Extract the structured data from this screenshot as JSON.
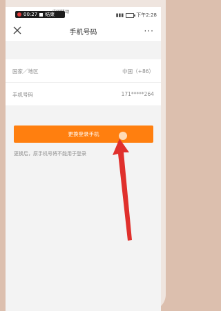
{
  "status_bar": {
    "carrier": "中国移动",
    "record_time": "00:27",
    "end_label": "结束",
    "time": "下午2:28"
  },
  "header": {
    "title": "手机号码",
    "more_label": "···"
  },
  "rows": [
    {
      "label": "国家／地区",
      "value": "中国（+86）"
    },
    {
      "label": "手机号码",
      "value": "171*****264"
    }
  ],
  "action": {
    "button_label": "更换登录手机",
    "hint": "更换后，原手机号将不能用于登录"
  },
  "colors": {
    "accent": "#ff7f0f",
    "arrow": "#e0302c",
    "background": "#f3f3f3"
  }
}
